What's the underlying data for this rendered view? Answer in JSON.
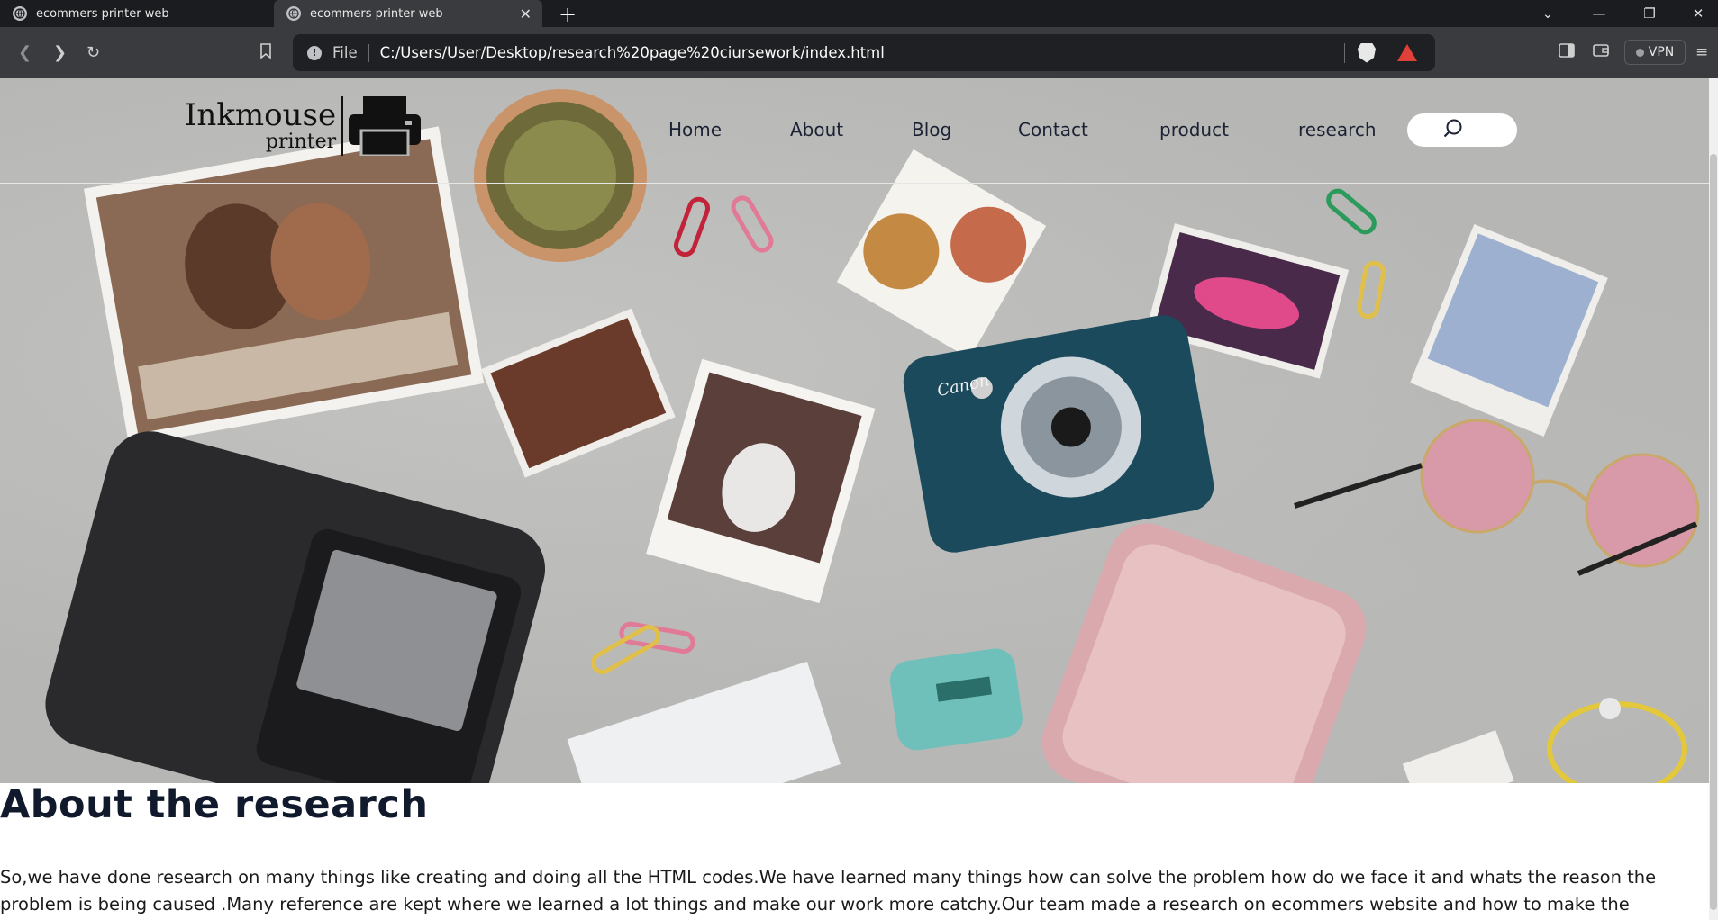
{
  "browser": {
    "tabs": [
      {
        "title": "ecommers printer web",
        "active": false
      },
      {
        "title": "ecommers printer web",
        "active": true
      }
    ],
    "address": {
      "scheme_label": "File",
      "url": "C:/Users/User/Desktop/research%20page%20ciursework/index.html"
    },
    "vpn_label": "VPN"
  },
  "page": {
    "logo": {
      "line1": "Inkmouse",
      "line2": "printer"
    },
    "nav": [
      "Home",
      "About",
      "Blog",
      "Contact",
      "product",
      "research"
    ],
    "hero_image": {
      "camera_brand": "Canon"
    },
    "heading": "About the research",
    "body": "So,we have done research on many things like creating and doing all the HTML codes.We have learned many things how can solve the problem how do we face it and whats the reason the problem is being caused .Many reference are kept where we learned a lot things and make our work more catchy.Our team made a research on ecommers website and how to make the"
  }
}
